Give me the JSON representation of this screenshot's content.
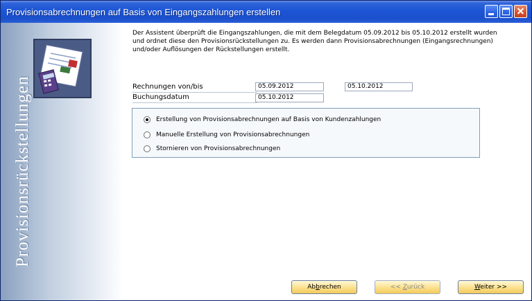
{
  "window": {
    "title": "Provisionsabrechnungen auf Basis von Eingangszahlungen erstellen"
  },
  "sidebar": {
    "vertical_text": "Provisionsrückstellungen"
  },
  "description": "Der Assistent überprüft die Eingangszahlungen, die mit dem Belegdatum 05.09.2012 bis  05.10.2012 erstellt wurden und ordnet diese den Provisionsrückstellungen zu. Es werden dann Provisionsabrechnungen (Eingangsrechnungen) und/oder Auflösungen der Rückstellungen erstellt.",
  "form": {
    "invoices_label": "Rechnungen von/bis",
    "invoices_from": "05.09.2012",
    "invoices_to": "05.10.2012",
    "posting_date_label": "Buchungsdatum",
    "posting_date": "05.10.2012"
  },
  "options": [
    {
      "label": "Erstellung von Provisionsabrechnungen auf Basis von Kundenzahlungen",
      "checked": true
    },
    {
      "label": "Manuelle Erstellung von Provisionsabrechnungen",
      "checked": false
    },
    {
      "label": "Stornieren von Provisionsabrechnungen",
      "checked": false
    }
  ],
  "buttons": {
    "cancel_pre": "Ab",
    "cancel_key": "b",
    "cancel_post": "rechen",
    "back_pre": "<< ",
    "back_key": "Z",
    "back_post": "urück",
    "next_key": "W",
    "next_post": "eiter >>"
  },
  "colors": {
    "titlebar": "#1c55d6",
    "button": "#fbe08c",
    "group_border": "#7f9db9"
  }
}
